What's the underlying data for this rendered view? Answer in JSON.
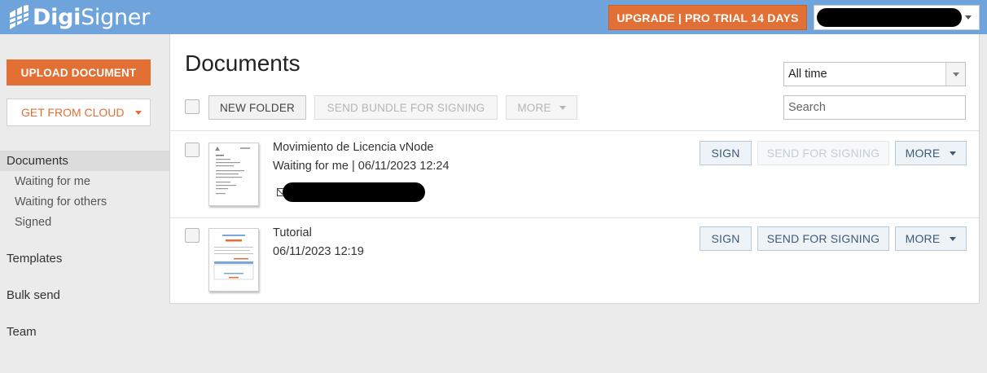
{
  "header": {
    "logo_text_bold": "Digi",
    "logo_text_light": "Signer",
    "upgrade_label": "UPGRADE | PRO TRIAL 14 DAYS"
  },
  "sidebar": {
    "upload_label": "UPLOAD DOCUMENT",
    "cloud_label": "GET FROM CLOUD",
    "items": [
      {
        "label": "Documents"
      },
      {
        "label": "Waiting for me"
      },
      {
        "label": "Waiting for others"
      },
      {
        "label": "Signed"
      },
      {
        "label": "Templates"
      },
      {
        "label": "Bulk send"
      },
      {
        "label": "Team"
      }
    ]
  },
  "main": {
    "title": "Documents",
    "toolbar": {
      "new_folder": "NEW FOLDER",
      "send_bundle": "SEND BUNDLE FOR SIGNING",
      "more": "MORE"
    },
    "filter": {
      "selected": "All time"
    },
    "search": {
      "placeholder": "Search"
    },
    "documents": [
      {
        "title": "Movimiento de Licencia vNode",
        "meta": "Waiting for me | 06/11/2023 12:24",
        "sign": "SIGN",
        "send": "SEND FOR SIGNING",
        "more": "MORE"
      },
      {
        "title": "Tutorial",
        "meta": "06/11/2023 12:19",
        "sign": "SIGN",
        "send": "SEND FOR SIGNING",
        "more": "MORE"
      }
    ]
  },
  "colors": {
    "header_bg": "#6fa3dc",
    "accent_orange": "#e27034",
    "panel_bg": "#ffffff",
    "page_bg": "#ebebeb"
  },
  "icons": [
    "logo-icon",
    "chevron-down-icon",
    "mail-icon"
  ]
}
